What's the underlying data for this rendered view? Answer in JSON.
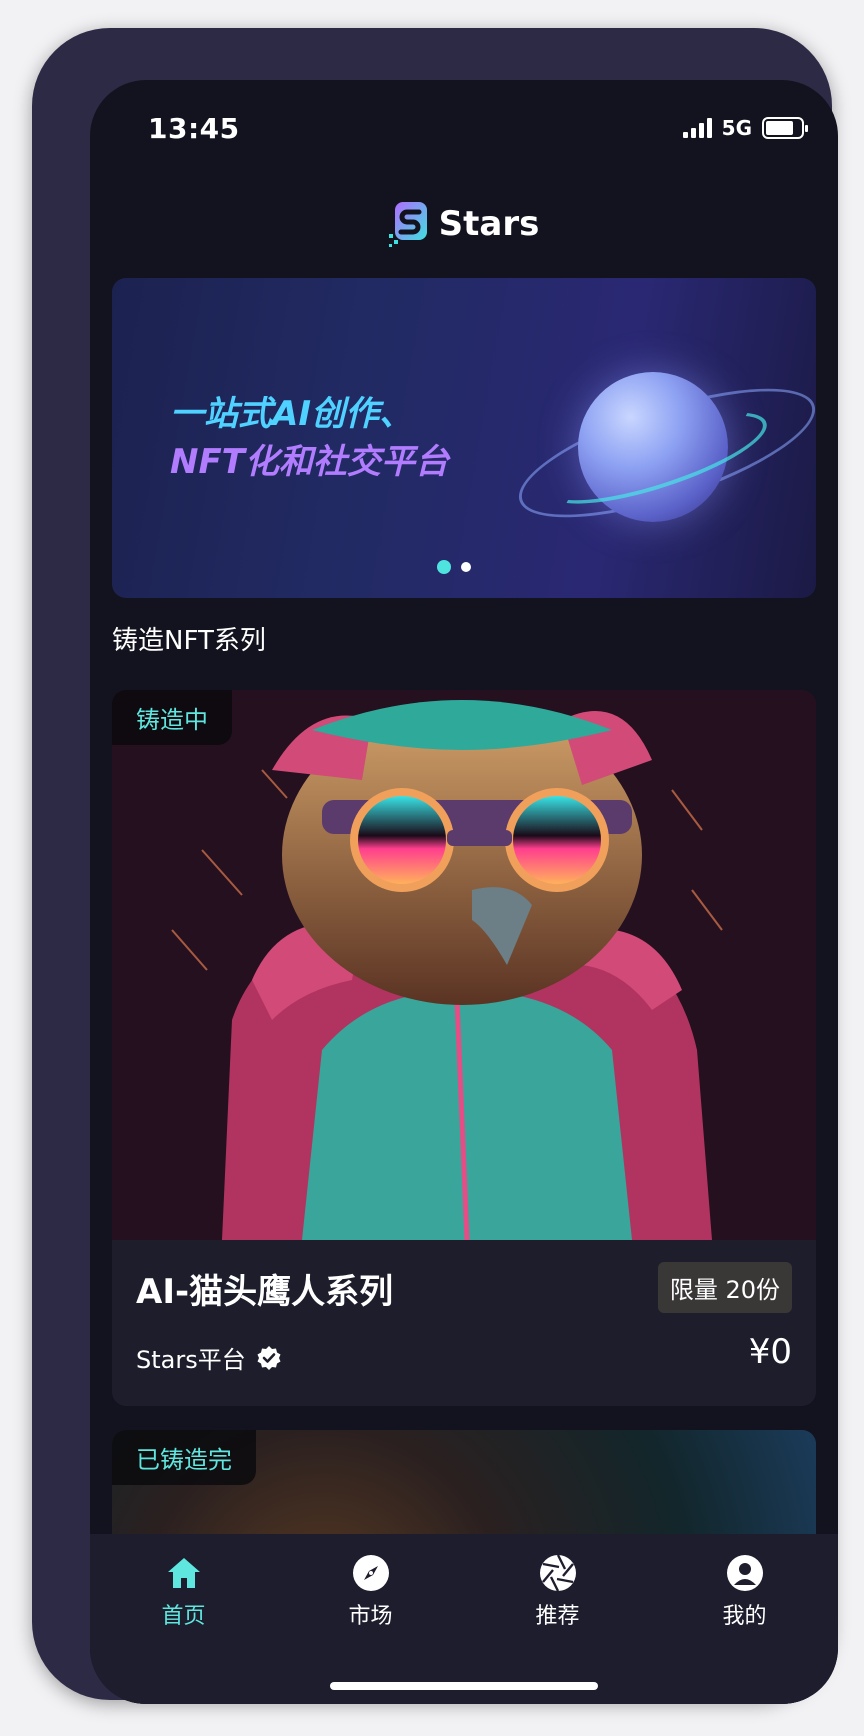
{
  "status_bar": {
    "time": "13:45",
    "network": "5G"
  },
  "app": {
    "name": "Stars"
  },
  "banner": {
    "line1": "一站式AI创作、",
    "line2": "NFT化和社交平台",
    "active_dot": 0
  },
  "section": {
    "title": "铸造NFT系列"
  },
  "cards": [
    {
      "status": "铸造中",
      "title": "AI-猫头鹰人系列",
      "limit": "限量 20份",
      "creator": "Stars平台",
      "price": "¥0"
    },
    {
      "status": "已铸造完"
    }
  ],
  "tabbar": {
    "items": [
      {
        "label": "首页",
        "icon": "home-icon"
      },
      {
        "label": "市场",
        "icon": "compass-icon"
      },
      {
        "label": "推荐",
        "icon": "aperture-icon"
      },
      {
        "label": "我的",
        "icon": "user-circle-icon"
      }
    ],
    "active": 0
  },
  "colors": {
    "accent": "#5fe6df",
    "background": "#13131f",
    "card": "#1d1d2c"
  }
}
